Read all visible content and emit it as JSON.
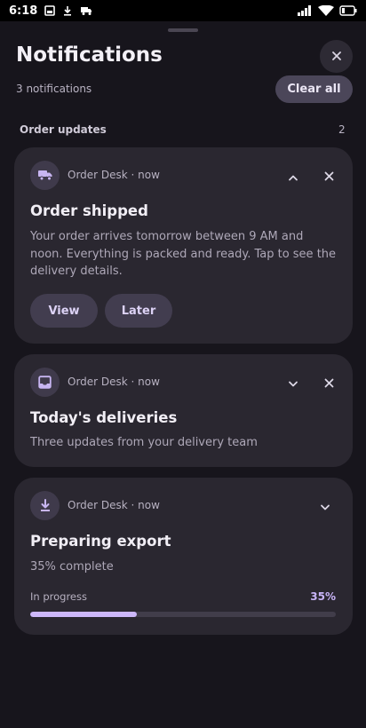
{
  "status_bar": {
    "time": "6:18"
  },
  "header": {
    "title": "Notifications",
    "count_text": "3 notifications",
    "clear_all_label": "Clear all"
  },
  "section": {
    "title": "Order updates",
    "count": "2"
  },
  "notifications": [
    {
      "app_meta": "Order Desk · now",
      "icon": "truck-icon",
      "title": "Order shipped",
      "body": "Your order arrives tomorrow between 9 AM and noon. Everything is packed and ready. Tap to see the delivery details.",
      "actions": [
        "View",
        "Later"
      ],
      "expanded": true
    },
    {
      "app_meta": "Order Desk · now",
      "icon": "inbox-icon",
      "title": "Today's deliveries",
      "body": "Three updates from your delivery team",
      "expanded": false
    },
    {
      "app_meta": "Order Desk · now",
      "icon": "download-icon",
      "title": "Preparing export",
      "body": "35% complete",
      "progress": {
        "label": "In progress",
        "percent_text": "35%",
        "value": 0.35
      }
    }
  ],
  "colors": {
    "background": "#17151c",
    "card": "#2a2730",
    "accent": "#cdb8fa"
  }
}
